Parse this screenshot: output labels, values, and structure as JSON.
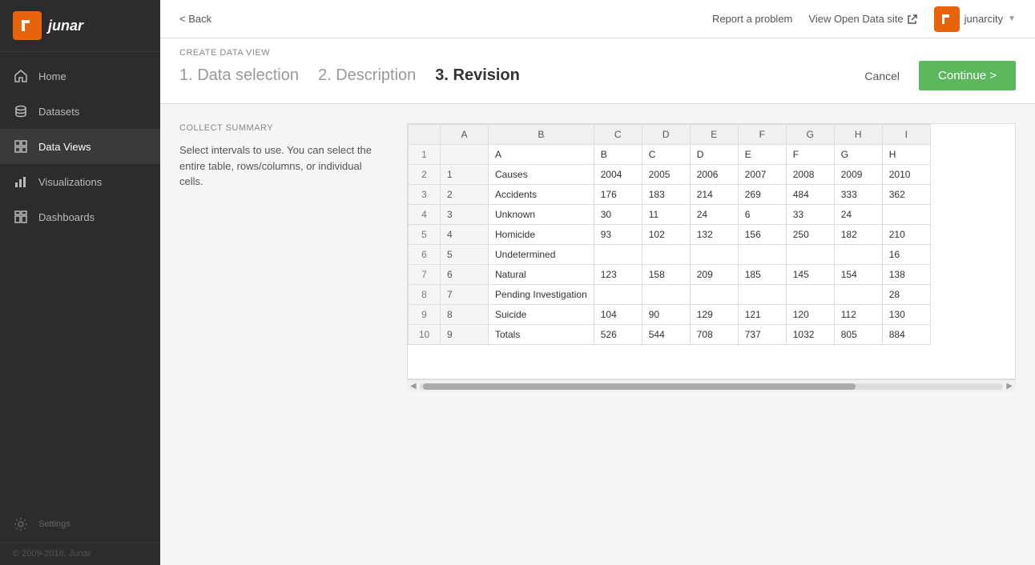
{
  "sidebar": {
    "logo": "J",
    "logo_text": "junar",
    "items": [
      {
        "id": "home",
        "label": "Home",
        "icon": "home"
      },
      {
        "id": "datasets",
        "label": "Datasets",
        "icon": "database"
      },
      {
        "id": "dataviews",
        "label": "Data Views",
        "icon": "grid",
        "active": true
      },
      {
        "id": "visualizations",
        "label": "Visualizations",
        "icon": "chart"
      },
      {
        "id": "dashboards",
        "label": "Dashboards",
        "icon": "dashboard"
      }
    ],
    "settings": "Settings",
    "footer": "© 2009-2016, Junar"
  },
  "topbar": {
    "back_label": "< Back",
    "report_label": "Report a problem",
    "open_data_label": "View Open Data site",
    "user_initial": "j",
    "user_name": "junarcity",
    "dropdown_arrow": "▼"
  },
  "header": {
    "create_label": "CREATE DATA VIEW",
    "step1": "1. Data selection",
    "step2": "2. Description",
    "step3": "3. Revision",
    "cancel_label": "Cancel",
    "continue_label": "Continue >"
  },
  "left_panel": {
    "title": "COLLECT SUMMARY",
    "description": "Select intervals to use. You can select the entire table, rows/columns, or individual cells."
  },
  "table": {
    "col_headers": [
      "",
      "A",
      "B",
      "C",
      "D",
      "E",
      "F",
      "G",
      "H",
      "I"
    ],
    "row_headers": [
      "A",
      "B",
      "C",
      "D",
      "E",
      "F",
      "G",
      "H"
    ],
    "rows": [
      {
        "num": "1",
        "a": "",
        "b": "A",
        "c": "B",
        "d": "C",
        "e": "D",
        "f": "E",
        "g": "F",
        "h": "G",
        "i": "H"
      },
      {
        "num": "2",
        "a": "1",
        "b": "Causes",
        "c": "2004",
        "d": "2005",
        "e": "2006",
        "f": "2007",
        "g": "2008",
        "h": "2009",
        "i": "2010"
      },
      {
        "num": "3",
        "a": "2",
        "b": "Accidents",
        "c": "176",
        "d": "183",
        "e": "214",
        "f": "269",
        "g": "484",
        "h": "333",
        "i": "362"
      },
      {
        "num": "4",
        "a": "3",
        "b": "Unknown",
        "c": "30",
        "d": "11",
        "e": "24",
        "f": "6",
        "g": "33",
        "h": "24",
        "i": ""
      },
      {
        "num": "5",
        "a": "4",
        "b": "Homicide",
        "c": "93",
        "d": "102",
        "e": "132",
        "f": "156",
        "g": "250",
        "h": "182",
        "i": "210"
      },
      {
        "num": "6",
        "a": "5",
        "b": "Undetermined",
        "c": "",
        "d": "",
        "e": "",
        "f": "",
        "g": "",
        "h": "",
        "i": "16"
      },
      {
        "num": "7",
        "a": "6",
        "b": "Natural",
        "c": "123",
        "d": "158",
        "e": "209",
        "f": "185",
        "g": "145",
        "h": "154",
        "i": "138"
      },
      {
        "num": "8",
        "a": "7",
        "b": "Pending Investigation",
        "c": "",
        "d": "",
        "e": "",
        "f": "",
        "g": "",
        "h": "",
        "i": "28"
      },
      {
        "num": "9",
        "a": "8",
        "b": "Suicide",
        "c": "104",
        "d": "90",
        "e": "129",
        "f": "121",
        "g": "120",
        "h": "112",
        "i": "130"
      },
      {
        "num": "10",
        "a": "9",
        "b": "Totals",
        "c": "526",
        "d": "544",
        "e": "708",
        "f": "737",
        "g": "1032",
        "h": "805",
        "i": "884"
      }
    ]
  },
  "footer": {
    "copyright": "© 2009-2016, Junar"
  }
}
